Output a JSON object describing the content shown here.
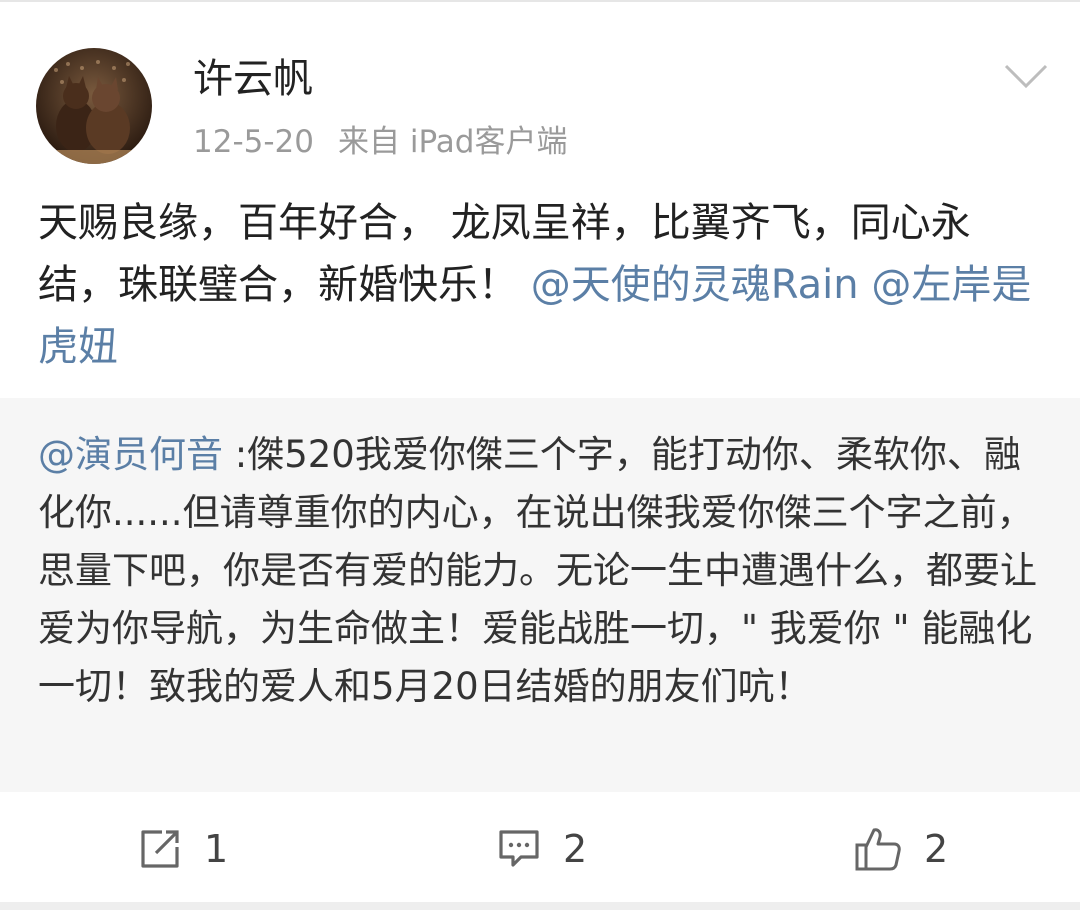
{
  "post": {
    "author": "许云帆",
    "date": "12-5-20",
    "source": "来自 iPad客户端",
    "text_plain": "天赐良缘，百年好合， 龙凤呈祥，比翼齐飞，同心永结，珠联璧合，新婚快乐！ ",
    "mention_1": "@天使的灵魂Rain",
    "mention_2": "@左岸是虎妞"
  },
  "repost": {
    "mention": "@演员何音",
    "text": " :傑520我爱你傑三个字，能打动你、柔软你、融化你......但请尊重你的内心，在说出傑我爱你傑三个字之前，思量下吧，你是否有爱的能力。无论一生中遭遇什么，都要让爱为你导航，为生命做主！爱能战胜一切，\" 我爱你 \" 能融化一切！致我的爱人和5月20日结婚的朋友们吭！"
  },
  "actions": {
    "repost_count": "1",
    "comment_count": "2",
    "like_count": "2"
  },
  "icons": {
    "repost": "share-icon",
    "comment": "comment-icon",
    "like": "thumbs-up-icon",
    "menu": "chevron-down-icon"
  },
  "colors": {
    "mention": "#5b7fa6",
    "meta": "#9a9a9a",
    "repost_bg": "#f6f6f6"
  }
}
